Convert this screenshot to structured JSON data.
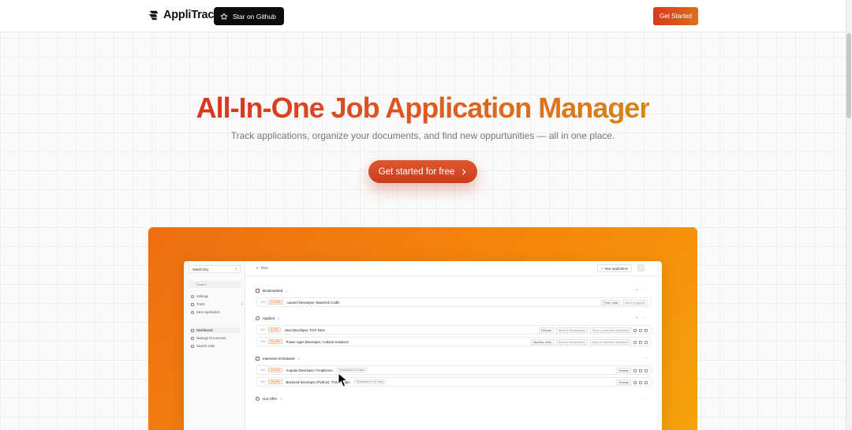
{
  "nav": {
    "brand": "AppliTrack",
    "github_label": "Star on Github",
    "get_started_label": "Get Started"
  },
  "hero": {
    "title": "All-In-One Job Application Manager",
    "subtitle": "Track applications, organize your documents, and find new oppurtunities — all in one place.",
    "cta_label": "Get started for free"
  },
  "colors": {
    "accent_start": "#d9331f",
    "accent_end": "#d8861a",
    "showcase_start": "#ef6e10",
    "showcase_end": "#f6a20a"
  },
  "app": {
    "account": "Niladri Dey",
    "search_placeholder": "Search",
    "sidebar_top": [
      {
        "label": "Settings",
        "icon": "gear-icon"
      },
      {
        "label": "Trash",
        "icon": "trash-icon",
        "count": "2"
      },
      {
        "label": "New Application",
        "icon": "plus-icon"
      }
    ],
    "sidebar_nav": [
      {
        "label": "Dashboard",
        "icon": "dashboard-icon",
        "active": true
      },
      {
        "label": "Manage Documents",
        "icon": "document-icon"
      },
      {
        "label": "Search Jobs",
        "icon": "search-icon"
      }
    ],
    "filter_label": "Filter",
    "new_application_label": "New application",
    "groups": [
      {
        "label": "Bookmarked",
        "count": "1"
      },
      {
        "label": "Applied",
        "count": "2"
      },
      {
        "label": "Interview Scheduled",
        "count": "2"
      },
      {
        "label": "Got Offer",
        "count": "0"
      }
    ],
    "rows": {
      "bookmarked": [
        {
          "date": "04/1",
          "salary": "4.5 LPA",
          "title": "Lavarel Developer, Maverick Crafts",
          "location": "Pune, India",
          "action": "Move to Applied"
        }
      ],
      "applied": [
        {
          "date": "04/1",
          "salary": "8 LPA",
          "title": "Java Developer, Tech Next",
          "location": "Remote",
          "action1": "Move to Bookmarked",
          "action2": "Move to Interview Scheduled"
        },
        {
          "date": "28/1",
          "salary": "12 LPA",
          "title": "Power Apps Developer, Codash Solutions",
          "location": "Mumbai, India",
          "action1": "Move to Bookmarked",
          "action2": "Move to Interview Scheduled"
        }
      ],
      "interview": [
        {
          "date": "18/1",
          "salary": "10 LPA",
          "title": "Angular Developer, Freightcom",
          "schedule": "Scheduled in 5 days",
          "location": "Remote"
        },
        {
          "date": "18/1",
          "salary": "15 LPA",
          "title": "Backend Developer (Python), Think Studio",
          "schedule": "Scheduled in 14 days",
          "location": "Remote"
        }
      ]
    }
  }
}
